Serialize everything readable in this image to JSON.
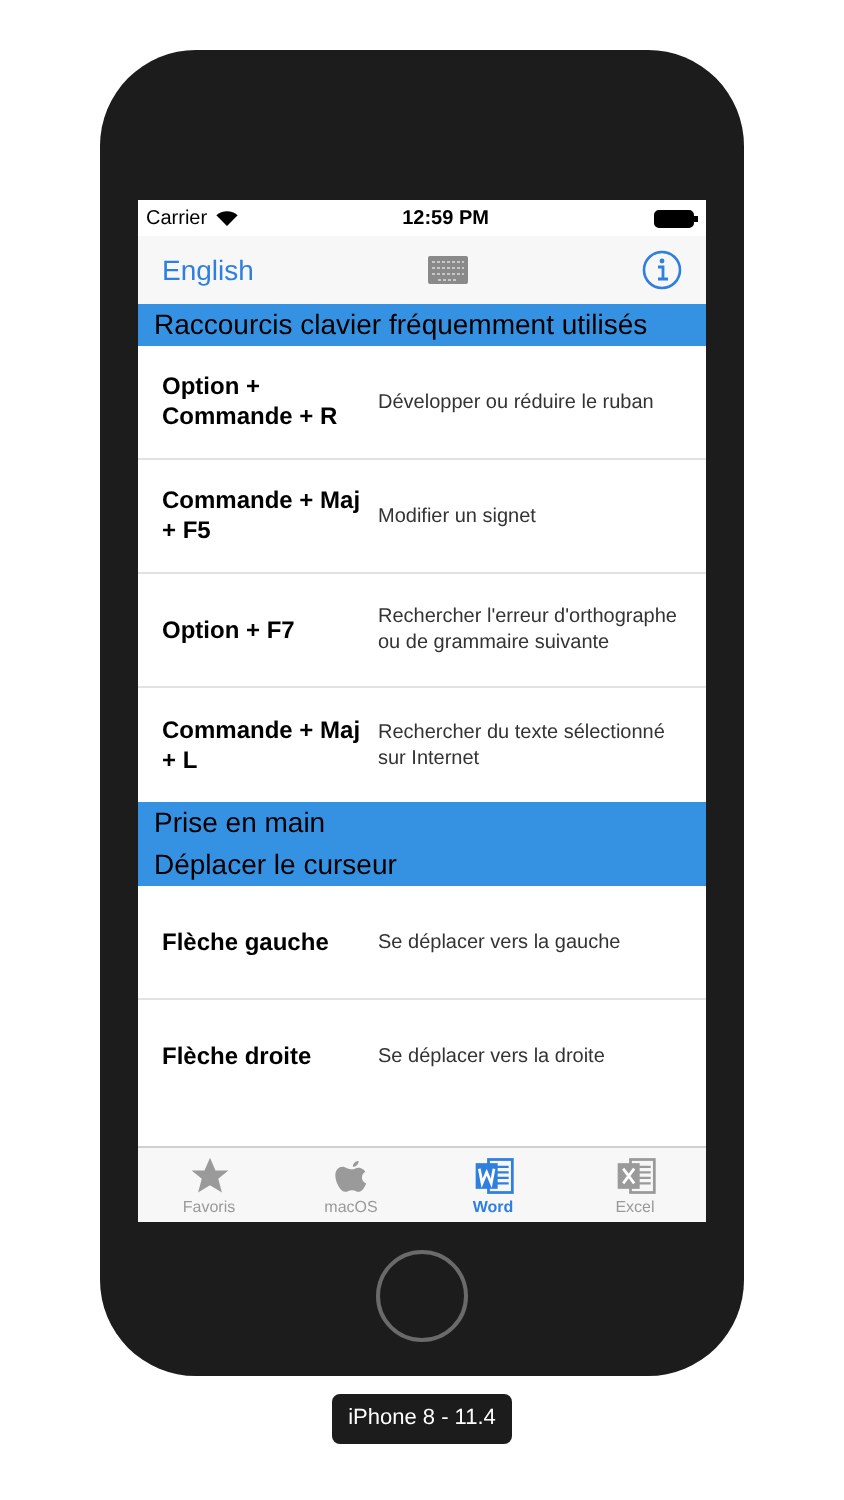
{
  "status_bar": {
    "carrier": "Carrier",
    "time": "12:59 PM"
  },
  "nav_bar": {
    "left_link": "English"
  },
  "sections": [
    {
      "titles": [
        "Raccourcis clavier fréquemment utilisés"
      ],
      "rows": [
        {
          "key": "Option + Commande + R",
          "action": "Développer ou réduire le ruban"
        },
        {
          "key": "Commande + Maj + F5",
          "action": "Modifier un signet"
        },
        {
          "key": "Option + F7",
          "action": "Rechercher l'erreur d'orthographe ou de grammaire suivante"
        },
        {
          "key": "Commande + Maj + L",
          "action": "Rechercher du texte sélectionné sur Internet"
        }
      ]
    },
    {
      "titles": [
        "Prise en main",
        "Déplacer le curseur"
      ],
      "rows": [
        {
          "key": "Flèche gauche",
          "action": "Se déplacer vers la gauche"
        },
        {
          "key": "Flèche droite",
          "action": "Se déplacer vers la droite"
        }
      ]
    }
  ],
  "tab_bar": [
    {
      "kind": "star",
      "label": "Favoris",
      "selected": false
    },
    {
      "kind": "apple",
      "label": "macOS",
      "selected": false
    },
    {
      "kind": "word",
      "label": "Word",
      "selected": true
    },
    {
      "kind": "excel",
      "label": "Excel",
      "selected": false
    }
  ],
  "device_label": "iPhone 8 - 11.4"
}
